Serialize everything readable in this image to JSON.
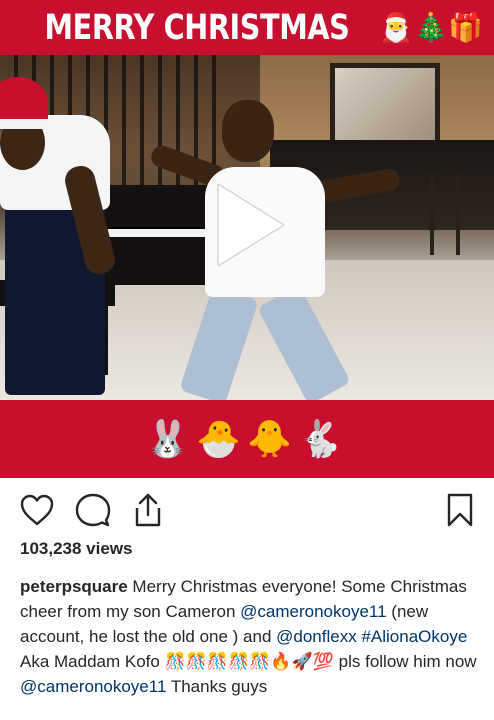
{
  "post": {
    "banner_title": "MERRY CHRISTMAS",
    "banner_emojis": "🎅🎄🎁",
    "bottom_emojis": "🐰🐣🐥🐇",
    "views": "103,238 views",
    "caption": {
      "username": "peterpsquare",
      "text_1": " Merry Christmas everyone! Some Christmas cheer from my son Cameron ",
      "mention_1": "@cameronokoye11",
      "text_2": " (new account, he lost the old one ) and ",
      "mention_2": "@donflexx",
      "text_3": " ",
      "hashtag_1": "#AlionaOkoye",
      "text_4": " Aka Maddam Kofo ",
      "emoji_run": "🎊🎊🎊🎊🎊🔥🚀💯",
      "text_5": " pls follow him now ",
      "mention_3": "@cameronokoye11",
      "text_6": " Thanks guys"
    }
  },
  "icons": {
    "like": "heart-icon",
    "comment": "comment-icon",
    "share": "share-icon",
    "save": "bookmark-icon",
    "play": "play-icon"
  },
  "colors": {
    "banner_red": "#c8102e",
    "text": "#262626",
    "link": "#003569"
  }
}
